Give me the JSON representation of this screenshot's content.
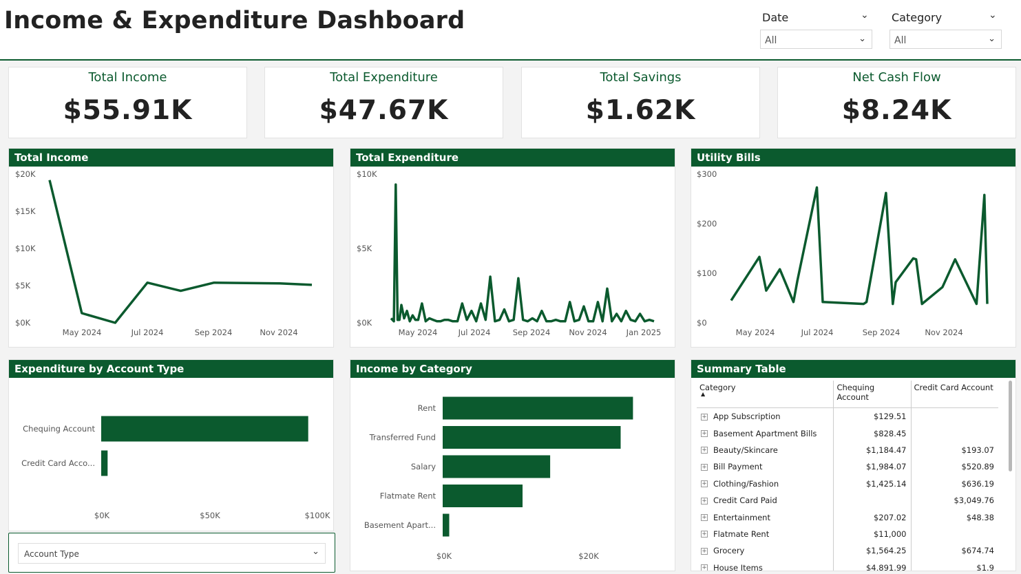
{
  "header": {
    "title": "Income & Expenditure Dashboard",
    "slicers": [
      {
        "label": "Date",
        "value": "All"
      },
      {
        "label": "Category",
        "value": "All"
      }
    ]
  },
  "kpis": [
    {
      "title": "Total Income",
      "value": "$55.91K"
    },
    {
      "title": "Total Expenditure",
      "value": "$47.67K"
    },
    {
      "title": "Total Savings",
      "value": "$1.62K"
    },
    {
      "title": "Net Cash Flow",
      "value": "$8.24K"
    }
  ],
  "colors": {
    "accent": "#0b5a2e",
    "line": "#0b5a2e",
    "bar": "#0b5a2e"
  },
  "panels": {
    "income": "Total Income",
    "expenditure": "Total Expenditure",
    "utility": "Utility Bills",
    "account": "Expenditure by Account Type",
    "category": "Income by Category",
    "summary": "Summary Table"
  },
  "account_slicer": {
    "placeholder": "Account Type"
  },
  "chart_data": [
    {
      "id": "income",
      "type": "line",
      "title": "Total Income",
      "y_ticks": [
        "$20K",
        "$15K",
        "$10K",
        "$5K",
        "$0K"
      ],
      "x_ticks": [
        "May 2024",
        "Jul 2024",
        "Sep 2024",
        "Nov 2024"
      ],
      "ylim": [
        0,
        20000
      ],
      "x": [
        "2024-04-01",
        "2024-05-01",
        "2024-06-01",
        "2024-07-01",
        "2024-08-01",
        "2024-09-01",
        "2024-10-01",
        "2024-11-01",
        "2024-12-01"
      ],
      "values": [
        19200,
        1300,
        0,
        5400,
        4300,
        5400,
        5350,
        5300,
        5100
      ]
    },
    {
      "id": "expenditure",
      "type": "line",
      "title": "Total Expenditure",
      "y_ticks": [
        "$10K",
        "$5K",
        "$0K"
      ],
      "x_ticks": [
        "May 2024",
        "Jul 2024",
        "Sep 2024",
        "Nov 2024",
        "Jan 2025"
      ],
      "ylim": [
        0,
        10000
      ],
      "x": [
        "2024-04-01",
        "2024-04-04",
        "2024-04-06",
        "2024-04-08",
        "2024-04-10",
        "2024-04-12",
        "2024-04-15",
        "2024-04-18",
        "2024-04-21",
        "2024-04-24",
        "2024-04-27",
        "2024-04-30",
        "2024-05-04",
        "2024-05-08",
        "2024-05-12",
        "2024-05-16",
        "2024-05-20",
        "2024-05-24",
        "2024-05-28",
        "2024-06-01",
        "2024-06-06",
        "2024-06-11",
        "2024-06-16",
        "2024-06-21",
        "2024-06-26",
        "2024-07-01",
        "2024-07-06",
        "2024-07-11",
        "2024-07-16",
        "2024-07-21",
        "2024-07-26",
        "2024-07-31",
        "2024-08-05",
        "2024-08-10",
        "2024-08-15",
        "2024-08-20",
        "2024-08-25",
        "2024-08-30",
        "2024-09-04",
        "2024-09-09",
        "2024-09-14",
        "2024-09-19",
        "2024-09-24",
        "2024-09-29",
        "2024-10-04",
        "2024-10-09",
        "2024-10-14",
        "2024-10-19",
        "2024-10-24",
        "2024-10-29",
        "2024-11-03",
        "2024-11-08",
        "2024-11-13",
        "2024-11-18",
        "2024-11-23",
        "2024-11-28",
        "2024-12-03",
        "2024-12-08",
        "2024-12-13",
        "2024-12-18",
        "2024-12-23",
        "2024-12-28",
        "2025-01-02",
        "2025-01-07"
      ],
      "values": [
        300,
        100,
        9300,
        200,
        200,
        1200,
        300,
        800,
        100,
        500,
        200,
        200,
        1300,
        100,
        300,
        200,
        100,
        100,
        200,
        200,
        100,
        100,
        1300,
        200,
        800,
        100,
        1300,
        200,
        3100,
        100,
        200,
        900,
        100,
        200,
        3000,
        200,
        100,
        300,
        100,
        800,
        100,
        100,
        200,
        100,
        100,
        1400,
        100,
        200,
        1100,
        100,
        100,
        1400,
        100,
        2300,
        100,
        600,
        100,
        800,
        200,
        100,
        600,
        100,
        200,
        100
      ]
    },
    {
      "id": "utility",
      "type": "line",
      "title": "Utility Bills",
      "y_ticks": [
        "$300",
        "$200",
        "$100",
        "$0"
      ],
      "x_ticks": [
        "May 2024",
        "Jul 2024",
        "Sep 2024",
        "Nov 2024"
      ],
      "ylim": [
        0,
        300
      ],
      "x": [
        "2024-04-01",
        "2024-04-30",
        "2024-05-07",
        "2024-05-21",
        "2024-06-04",
        "2024-06-08",
        "2024-06-28",
        "2024-07-04",
        "2024-08-15",
        "2024-08-18",
        "2024-09-07",
        "2024-09-14",
        "2024-09-17",
        "2024-10-05",
        "2024-10-08",
        "2024-10-14",
        "2024-11-04",
        "2024-11-17",
        "2024-12-09",
        "2024-12-17",
        "2024-12-20"
      ],
      "values": [
        45,
        133,
        65,
        108,
        42,
        85,
        273,
        42,
        38,
        42,
        262,
        38,
        82,
        130,
        128,
        38,
        72,
        128,
        38,
        258,
        38
      ]
    },
    {
      "id": "account",
      "type": "bar",
      "orientation": "horizontal",
      "title": "Expenditure by Account Type",
      "categories": [
        "Chequing Account",
        "Credit Card Acco..."
      ],
      "values": [
        97000,
        3000
      ],
      "x_ticks": [
        "$0K",
        "$50K",
        "$100K"
      ],
      "xlim": [
        0,
        100000
      ]
    },
    {
      "id": "category",
      "type": "bar",
      "orientation": "horizontal",
      "title": "Income by Category",
      "categories": [
        "Rent",
        "Transferred Fund",
        "Salary",
        "Flatmate Rent",
        "Basement Apart..."
      ],
      "values": [
        26200,
        24500,
        14800,
        11000,
        900
      ],
      "x_ticks": [
        "$0K",
        "$20K"
      ],
      "xlim": [
        0,
        20000
      ]
    }
  ],
  "summary_table": {
    "columns": [
      "Category",
      "Chequing Account",
      "Credit Card Account"
    ],
    "rows": [
      {
        "category": "App Subscription",
        "chequing": "$129.51",
        "credit": ""
      },
      {
        "category": "Basement Apartment Bills",
        "chequing": "$828.45",
        "credit": ""
      },
      {
        "category": "Beauty/Skincare",
        "chequing": "$1,184.47",
        "credit": "$193.07"
      },
      {
        "category": "Bill Payment",
        "chequing": "$1,984.07",
        "credit": "$520.89"
      },
      {
        "category": "Clothing/Fashion",
        "chequing": "$1,425.14",
        "credit": "$636.19"
      },
      {
        "category": "Credit Card Paid",
        "chequing": "",
        "credit": "$3,049.76"
      },
      {
        "category": "Entertainment",
        "chequing": "$207.02",
        "credit": "$48.38"
      },
      {
        "category": "Flatmate Rent",
        "chequing": "$11,000",
        "credit": ""
      },
      {
        "category": "Grocery",
        "chequing": "$1,564.25",
        "credit": "$674.74"
      },
      {
        "category": "House Items",
        "chequing": "$4,891.99",
        "credit": "$1.9"
      }
    ]
  }
}
